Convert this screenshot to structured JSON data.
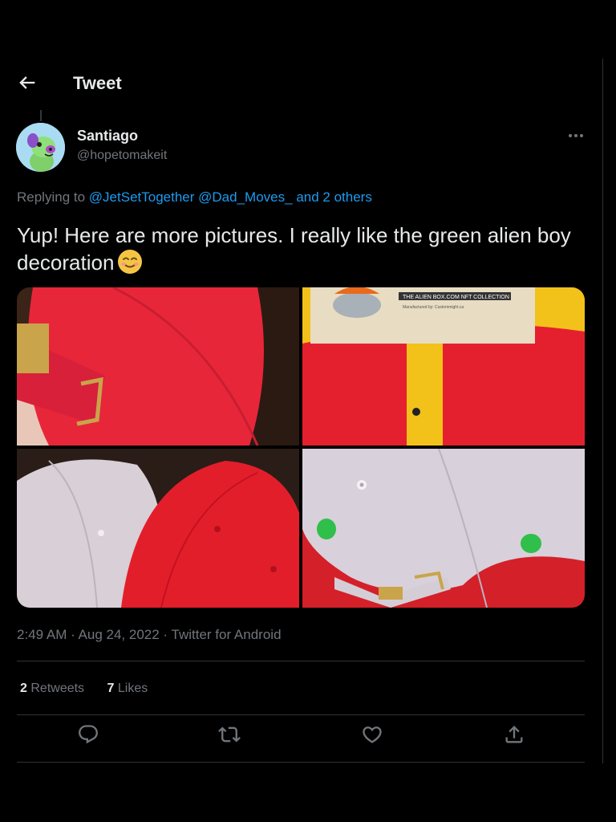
{
  "header": {
    "title": "Tweet"
  },
  "author": {
    "name": "Santiago",
    "handle": "@hopetomakeit"
  },
  "reply": {
    "prefix": "Replying to",
    "mention1": "@JetSetTogether",
    "mention2": "@Dad_Moves_",
    "others": "and 2 others"
  },
  "tweet": {
    "text": "Yup! Here are more pictures. I really like the green alien boy decoration",
    "emoji": "smiling-face-icon"
  },
  "media": {
    "tag_line1": "THE ALIEN BOX.COM NFT COLLECTION",
    "tag_line2": "Manufactured by: Custommight.ca"
  },
  "meta": {
    "time": "2:49 AM",
    "sep1": " · ",
    "date": "Aug 24, 2022",
    "sep2": " · ",
    "source": "Twitter for Android"
  },
  "stats": {
    "retweets_count": "2",
    "retweets_label": "Retweets",
    "likes_count": "7",
    "likes_label": "Likes"
  },
  "actions": [
    "reply-icon",
    "retweet-icon",
    "like-icon",
    "share-icon"
  ],
  "colors": {
    "accent": "#1d9bf0",
    "muted": "#71767b",
    "text": "#e7e9ea",
    "bg": "#000000"
  }
}
